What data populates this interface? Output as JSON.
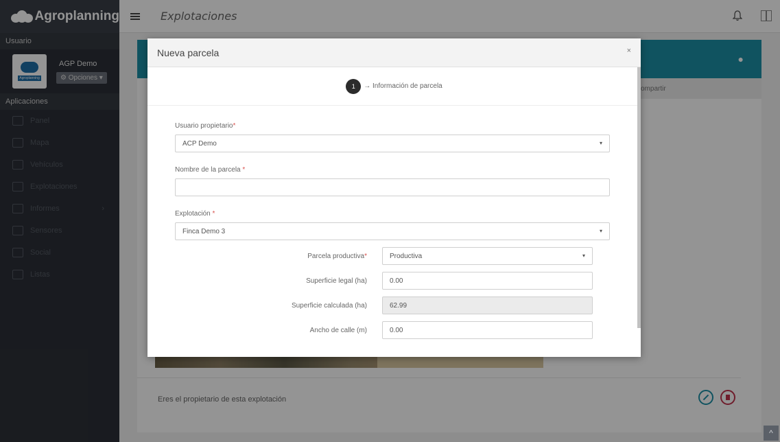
{
  "app": {
    "name": "Agroplanning",
    "page_title": "Explotaciones"
  },
  "sidebar": {
    "user_section": "Usuario",
    "user_name": "AGP Demo",
    "avatar_text": "Agroplanning",
    "options_label": "Opciones",
    "apps_section": "Aplicaciones",
    "items": [
      {
        "label": "Panel"
      },
      {
        "label": "Mapa"
      },
      {
        "label": "Vehículos"
      },
      {
        "label": "Explotaciones"
      },
      {
        "label": "Informes"
      },
      {
        "label": "Sensores"
      },
      {
        "label": "Social"
      },
      {
        "label": "Listas"
      }
    ]
  },
  "background": {
    "share_label": "ompartir",
    "owner_text": "Eres el propietario de esta explotación"
  },
  "modal": {
    "title": "Nueva parcela",
    "close": "×",
    "step_number": "1",
    "step_label": "→ Información de parcela",
    "owner_label": "Usuario propietario",
    "owner_value": "ACP Demo",
    "name_label": "Nombre de la parcela ",
    "name_value": "",
    "farm_label": "Explotación ",
    "farm_value": "Finca Demo 3",
    "productive_label": "Parcela productiva",
    "productive_value": "Productiva",
    "legal_area_label": "Superficie legal (ha)",
    "legal_area_value": "0.00",
    "calc_area_label": "Superficie calculada (ha)",
    "calc_area_value": "62.99",
    "street_width_label": "Ancho de calle (m)",
    "street_width_value": "0.00",
    "required_mark": "*",
    "caret": "▾"
  },
  "colors": {
    "accent": "#1d8fa6",
    "danger": "#c0334d",
    "sidebar": "#2c3037"
  }
}
